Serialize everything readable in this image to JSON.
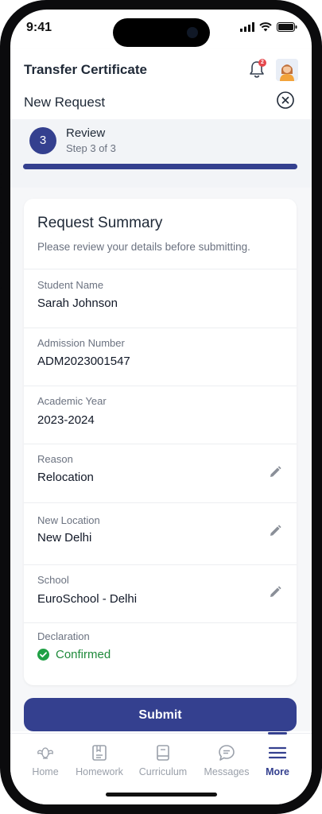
{
  "status_bar": {
    "time": "9:41"
  },
  "app_bar": {
    "title": "Transfer Certificate",
    "notification_count": "2"
  },
  "request": {
    "title": "New Request"
  },
  "stepper": {
    "number": "3",
    "title": "Review",
    "subtitle": "Step 3 of 3",
    "progress_fraction": 1.0
  },
  "summary": {
    "title": "Request Summary",
    "subtitle": "Please review your details before submitting.",
    "fields": [
      {
        "label": "Student Name",
        "value": "Sarah Johnson",
        "editable": false
      },
      {
        "label": "Admission Number",
        "value": "ADM2023001547",
        "editable": false
      },
      {
        "label": "Academic Year",
        "value": "2023-2024",
        "editable": false
      },
      {
        "label": "Reason",
        "value": "Relocation",
        "editable": true
      },
      {
        "label": "New Location",
        "value": "New Delhi",
        "editable": true
      },
      {
        "label": "School",
        "value": "EuroSchool - Delhi",
        "editable": true
      },
      {
        "label": "Declaration",
        "value": "Confirmed",
        "editable": false
      }
    ]
  },
  "submit_label": "Submit",
  "tabs": [
    {
      "label": "Home",
      "icon": "home-icon"
    },
    {
      "label": "Homework",
      "icon": "homework-icon"
    },
    {
      "label": "Curriculum",
      "icon": "curriculum-icon"
    },
    {
      "label": "Messages",
      "icon": "messages-icon"
    },
    {
      "label": "More",
      "icon": "menu-icon",
      "active": true
    }
  ],
  "colors": {
    "primary": "#34408f",
    "success": "#20a045",
    "danger": "#e5484d"
  }
}
